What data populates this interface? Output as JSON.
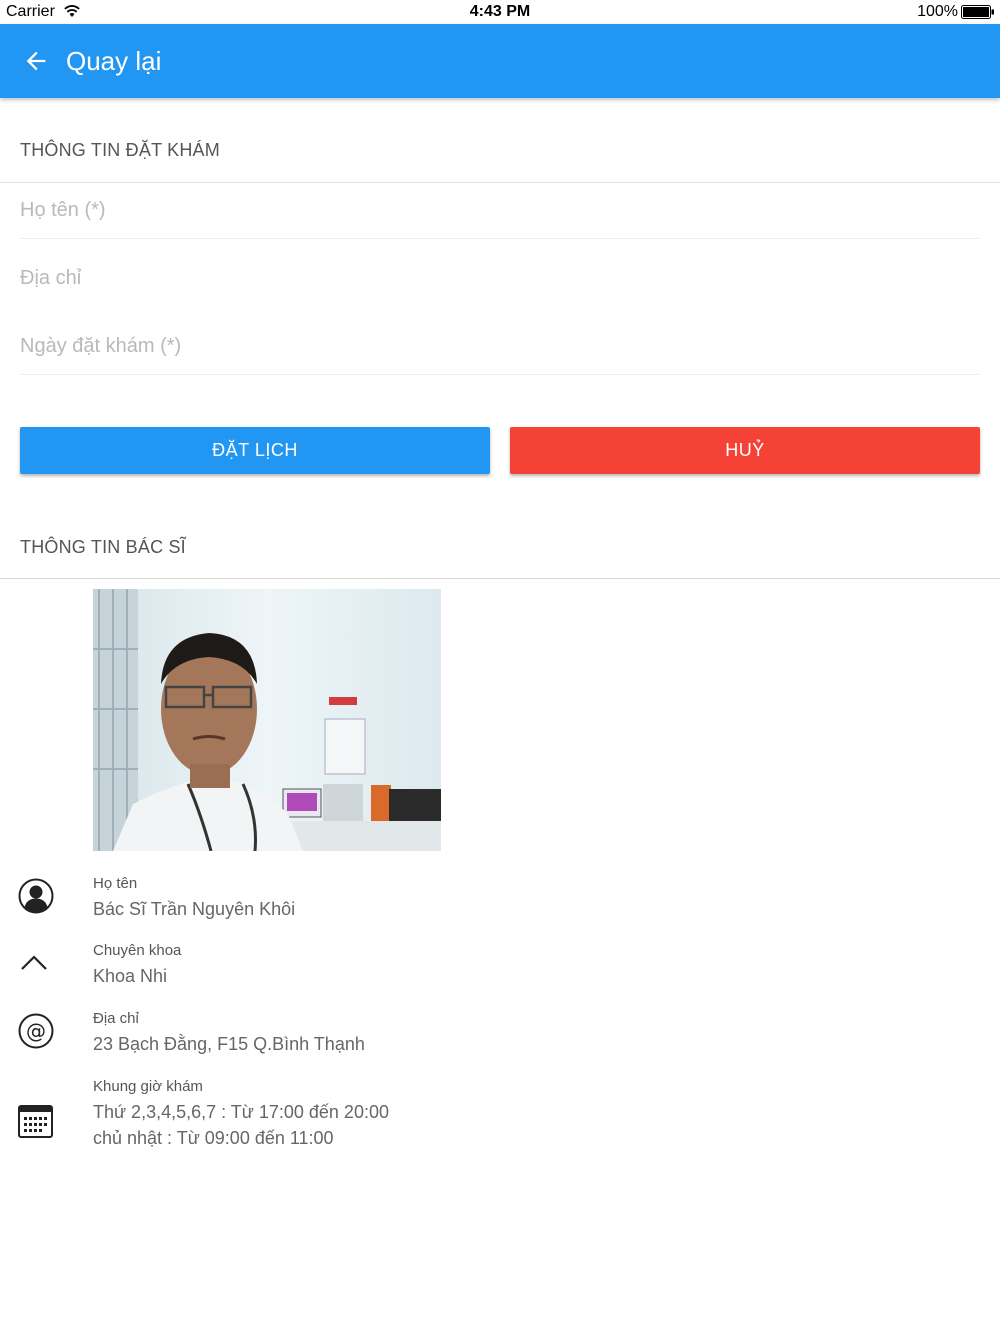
{
  "status_bar": {
    "carrier": "Carrier",
    "time": "4:43 PM",
    "battery": "100%"
  },
  "app_bar": {
    "back_label": "Quay lại",
    "color": "#2196f3"
  },
  "booking": {
    "section_title": "THÔNG TIN ĐẶT KHÁM",
    "name_placeholder": "Họ tên (*)",
    "address_placeholder": "Địa chỉ",
    "date_placeholder": "Ngày đặt khám (*)",
    "book_label": "ĐẶT LỊCH",
    "cancel_label": "HUỶ",
    "book_color": "#2196f3",
    "cancel_color": "#f44336"
  },
  "doctor": {
    "section_title": "THÔNG TIN BÁC SĨ",
    "photo_icon": "doctor-photo",
    "name_label": "Họ tên",
    "name_value": "Bác Sĩ Trần Nguyên Khôi",
    "specialty_label": "Chuyên khoa",
    "specialty_value": "Khoa Nhi",
    "address_label": "Địa chỉ",
    "address_value": "23 Bạch Đằng, F15 Q.Bình Thạnh",
    "hours_label": "Khung giờ khám",
    "hours_line1": "Thứ 2,3,4,5,6,7 : Từ 17:00 đến 20:00",
    "hours_line2": "chủ nhật : Từ 09:00 đến 11:00",
    "icons": [
      "person-icon",
      "chevron-up-icon",
      "at-sign-icon",
      "calendar-icon"
    ]
  }
}
